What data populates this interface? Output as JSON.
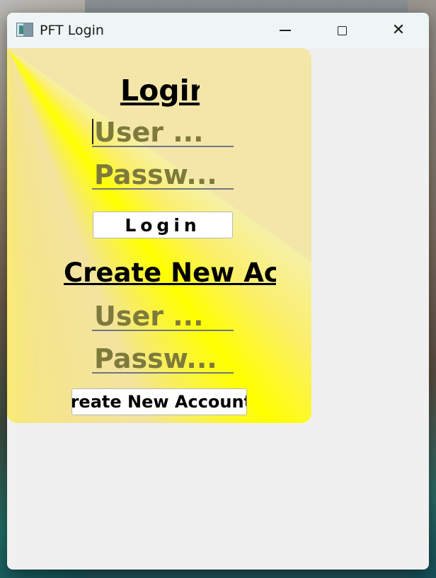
{
  "window": {
    "title": "PFT Login",
    "controls": {
      "minimize": "—",
      "maximize": "□",
      "close": "✕"
    }
  },
  "login": {
    "heading": "Login",
    "username_placeholder": "User ...",
    "password_placeholder": "Passw...",
    "button_label": "Login"
  },
  "create": {
    "heading": "Create New Account",
    "username_placeholder": "User ...",
    "password_placeholder": "Passw...",
    "button_label": "Create New Account"
  },
  "colors": {
    "panel_yellow": "#ffff00",
    "panel_cream": "#f3e6a8",
    "placeholder": "#7e7a3c",
    "window_bg": "#f0f0f0",
    "titlebar_bg": "#eef5f4"
  },
  "icons": [
    "app-window-icon",
    "minimize-icon",
    "maximize-icon",
    "close-icon"
  ]
}
